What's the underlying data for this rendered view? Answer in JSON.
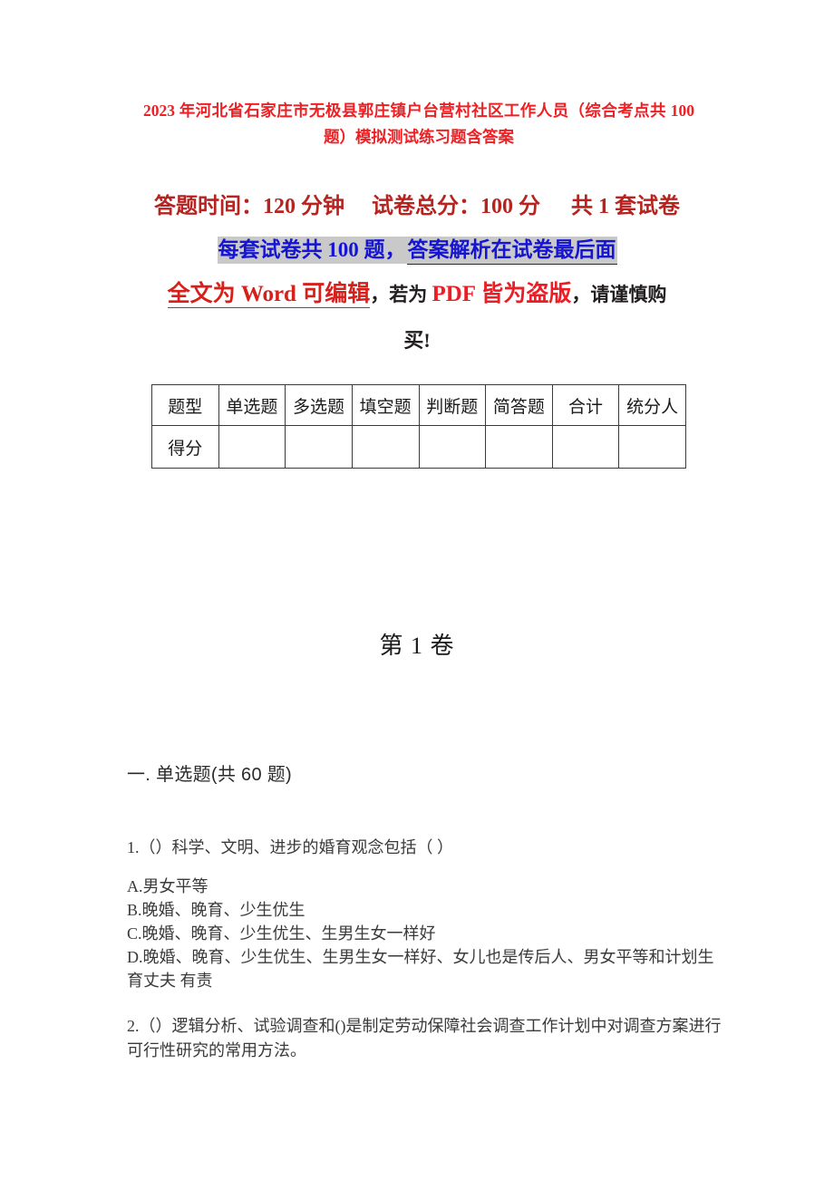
{
  "document": {
    "title": "2023 年河北省石家庄市无极县郭庄镇户台营村社区工作人员（综合考点共 100 题）模拟测试练习题含答案",
    "info": {
      "duration_label": "答题时间：120 分钟",
      "total_score_label": "试卷总分：100 分",
      "paper_count_label": "共 1 套试卷",
      "notice_plain": "每套试卷共 100 题，",
      "notice_underlined": "答案解析在试卷最后面",
      "copyright_part1": "全文为 Word 可编辑",
      "copyright_part2": "，若为 ",
      "copyright_part3": "PDF 皆为盗版",
      "copyright_part4": "，请谨慎购",
      "copyright_part5": "买!"
    },
    "score_table": {
      "headers": [
        "题型",
        "单选题",
        "多选题",
        "填空题",
        "判断题",
        "简答题",
        "合计",
        "统分人"
      ],
      "row_label": "得分",
      "row_values": [
        "",
        "",
        "",
        "",
        "",
        "",
        ""
      ]
    },
    "volume_heading": "第 1 卷",
    "section_heading": "一. 单选题(共 60 题)",
    "questions": [
      {
        "stem": "1.（）科学、文明、进步的婚育观念包括（ ）",
        "options": [
          "A.男女平等",
          "B.晚婚、晚育、少生优生",
          "C.晚婚、晚育、少生优生、生男生女一样好",
          "D.晚婚、晚育、少生优生、生男生女一样好、女儿也是传后人、男女平等和计划生育丈夫 有责"
        ]
      },
      {
        "stem": "2.（）逻辑分析、试验调查和()是制定劳动保障社会调查工作计划中对调查方案进行可行性研究的常用方法。",
        "options": []
      }
    ]
  },
  "colors": {
    "title_red": "#ef2024",
    "info_dark_red": "#b8231f",
    "notice_blue": "#1414d2",
    "highlight_gray": "#c9c9c9",
    "body_text": "#3a3a3a"
  }
}
